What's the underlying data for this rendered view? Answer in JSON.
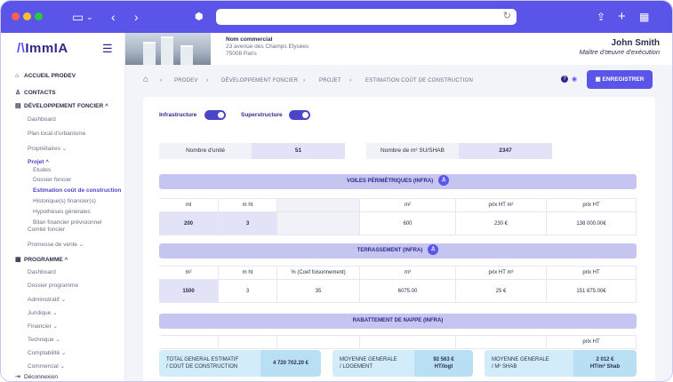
{
  "colors": {
    "accent": "#5b54e8",
    "accent_dark": "#2f2a8a",
    "section_bg": "#c6c5f2",
    "total_bg": "#d3ecf9"
  },
  "browser": {
    "window_controls": [
      "close",
      "minimize",
      "maximize"
    ],
    "icons": [
      "sidebar-toggle-icon",
      "chevron-down-icon",
      "back-icon",
      "forward-icon",
      "shield-icon",
      "reload-icon",
      "share-icon",
      "new-tab-icon",
      "tabs-grid-icon"
    ]
  },
  "sidebar": {
    "logo_prefix": "ImmIA",
    "items": [
      {
        "label": "ACCUEIL PRODEV",
        "icon": "home-icon",
        "type": "section"
      },
      {
        "label": "CONTACTS",
        "icon": "user-icon",
        "type": "section"
      },
      {
        "label": "DÉVELOPPEMENT FONCIER ^",
        "icon": "document-icon",
        "type": "section"
      },
      {
        "label": "Dashboard",
        "type": "sub"
      },
      {
        "label": "Plan local d'urbanisme",
        "type": "sub"
      },
      {
        "label": "Propriétaires ⌄",
        "type": "sub"
      },
      {
        "label": "Projet ^",
        "type": "sub-active"
      },
      {
        "label": "Etudes",
        "type": "sub2"
      },
      {
        "label": "Dossier foncier",
        "type": "sub2"
      },
      {
        "label": "Estimation coût de construction",
        "type": "sub2-active"
      },
      {
        "label": "Historique(s) financier(s)",
        "type": "sub2"
      },
      {
        "label": "Hypothèses générales",
        "type": "sub2"
      },
      {
        "label": "Bilan financier prévisionnel",
        "type": "sub2"
      },
      {
        "label": "Comité foncier",
        "type": "sub"
      },
      {
        "label": "Promesse de vente ⌄",
        "type": "sub"
      },
      {
        "label": "PROGRAMME ^",
        "icon": "calendar-icon",
        "type": "section"
      },
      {
        "label": "Dashboard",
        "type": "sub"
      },
      {
        "label": "Dossier programme",
        "type": "sub"
      },
      {
        "label": "Administratif ⌄",
        "type": "sub"
      },
      {
        "label": "Juridique ⌄",
        "type": "sub"
      },
      {
        "label": "Financier ⌄",
        "type": "sub"
      },
      {
        "label": "Technique ⌄",
        "type": "sub"
      },
      {
        "label": "Comptabilité ⌄",
        "type": "sub"
      },
      {
        "label": "Commercial ⌄",
        "type": "sub"
      },
      {
        "label": "Déconnexion",
        "icon": "logout-icon",
        "type": "sub"
      }
    ]
  },
  "header": {
    "company_name": "Nom commercial",
    "address_line1": "23 avenue des Champs Elysées",
    "address_line2": "75008 Paris",
    "user_name": "John Smith",
    "user_role": "Maître d'œuvre d'exécution"
  },
  "breadcrumb": {
    "items": [
      "PRODEV",
      "DÉVELOPPEMENT FONCIER",
      "PROJET",
      "ESTIMATION COÛT DE CONSTRUCTION"
    ],
    "save_label": "ENREGISTRER"
  },
  "toggles": [
    {
      "label": "Infrastructure",
      "on": true
    },
    {
      "label": "Superstructure",
      "on": true
    }
  ],
  "fields": {
    "units_label": "Nombre d'unité",
    "units_value": "51",
    "surface_label": "Nombre de m² SU/SHAB",
    "surface_value": "2347"
  },
  "sections": {
    "voiles": {
      "title": "VOILES PÉRIMÉTRIQUES (INFRA)",
      "headers": [
        "ml",
        "m ht",
        "",
        "m²",
        "prix HT m²",
        "prix HT"
      ],
      "row": [
        "200",
        "3",
        "",
        "600",
        "230 €",
        "138 000.00€"
      ]
    },
    "terrassement": {
      "title": "TERRASSEMENT (INFRA)",
      "headers": [
        "m²",
        "m ht",
        "% (Coef foisonnement)",
        "m³",
        "prix HT m³",
        "prix HT"
      ],
      "row": [
        "1500",
        "3",
        "35",
        "6075.00",
        "25 €",
        "151 875.00€"
      ]
    },
    "rabattement": {
      "title": "RABATTEMENT DE NAPPE (INFRA)",
      "headers": [
        "",
        "",
        "",
        "",
        "",
        "prix HT"
      ]
    }
  },
  "totals": [
    {
      "label_line1": "TOTAL GENERAL ESTIMATIF",
      "label_line2": "/ COUT DE CONSTRUCTION",
      "value_line1": "4 720 702.20 €",
      "value_line2": ""
    },
    {
      "label_line1": "MOYENNE GENERALE",
      "label_line2": "/ LOGEMENT",
      "value_line1": "92 563 €",
      "value_line2": "HT/logt"
    },
    {
      "label_line1": "MOYENNE GENERALE",
      "label_line2": "/ M² SHAB",
      "value_line1": "2 012 €",
      "value_line2": "HT/m² Shab"
    }
  ]
}
